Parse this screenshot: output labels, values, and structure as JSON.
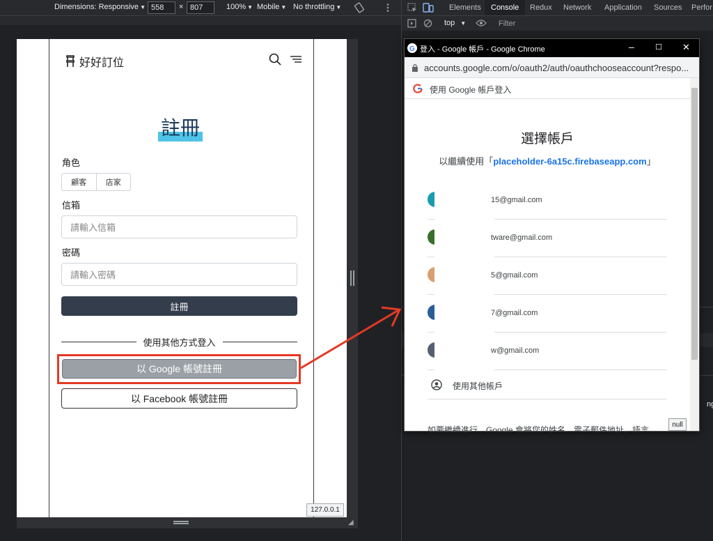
{
  "device_toolbar": {
    "dimensions": "Dimensions: Responsive",
    "width": "558",
    "height": "807",
    "times": "×",
    "zoom": "100%",
    "device": "Mobile",
    "throttle": "No throttling"
  },
  "devtools": {
    "tabs": [
      "Elements",
      "Console",
      "Redux",
      "Network",
      "Application",
      "Sources",
      "Perfor"
    ],
    "active_tab": "Console",
    "context": "top",
    "filter_placeholder": "Filter",
    "partial_text": "ng i"
  },
  "app": {
    "brand": "好好訂位",
    "page_title": "註冊",
    "role_label": "角色",
    "roles": [
      "顧客",
      "店家"
    ],
    "email_label": "信箱",
    "email_placeholder": "請輸入信箱",
    "password_label": "密碼",
    "password_placeholder": "請輸入密碼",
    "submit": "註冊",
    "divider_text": "使用其他方式登入",
    "google_button": "以 Google 帳號註冊",
    "facebook_button": "以 Facebook 帳號註冊",
    "status_url": "127.0.0.1"
  },
  "popup": {
    "window_title": "登入 - Google 帳戶 - Google Chrome",
    "url": "accounts.google.com/o/oauth2/auth/oauthchooseaccount?respo...",
    "header": "使用 Google 帳戶登入",
    "heading": "選擇帳戶",
    "subtitle_prefix": "以繼續使用「",
    "subtitle_app": "placeholder-6a15c.firebaseapp.com",
    "subtitle_suffix": "」",
    "accounts": [
      {
        "email": "15@gmail.com",
        "color": "#1a9bb0"
      },
      {
        "email": "tware@gmail.com",
        "color": "#3a6e2a"
      },
      {
        "email": "5@gmail.com",
        "color": "#d8a070"
      },
      {
        "email": "7@gmail.com",
        "color": "#2a5c9a"
      },
      {
        "email": "w@gmail.com",
        "color": "#556070"
      }
    ],
    "other_account": "使用其他帳戶",
    "footer": "如要繼續進行，Google 會將您的姓名、電子郵件地址、語言",
    "null_badge": "null"
  },
  "colors": {
    "annotation": "#e53a25",
    "link": "#1a73e8",
    "highlight": "#4fc3e8"
  }
}
